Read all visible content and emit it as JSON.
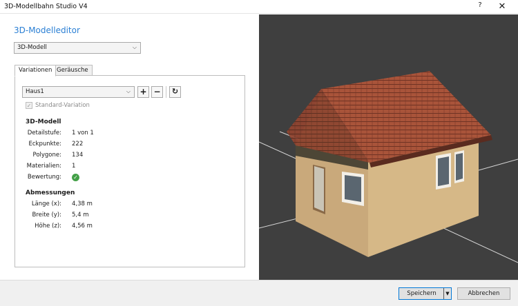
{
  "window": {
    "title": "3D-Modellbahn Studio V4",
    "help_label": "?",
    "close_label": "✕"
  },
  "editor": {
    "heading": "3D-Modelleditor",
    "model_select_value": "3D-Modell",
    "tabs": [
      "Variationen",
      "Geräusche"
    ],
    "variation_select_value": "Haus1",
    "add_label": "+",
    "remove_label": "−",
    "refresh_icon": "↻",
    "standard_variation_label": "Standard-Variation",
    "model_section": {
      "title": "3D-Modell",
      "rows": [
        {
          "label": "Detailstufe:",
          "value": "1 von 1"
        },
        {
          "label": "Eckpunkte:",
          "value": "222"
        },
        {
          "label": "Polygone:",
          "value": "134"
        },
        {
          "label": "Materialien:",
          "value": "1"
        },
        {
          "label": "Bewertung:",
          "value": ""
        }
      ]
    },
    "dimensions_section": {
      "title": "Abmessungen",
      "rows": [
        {
          "label": "Länge (x):",
          "value": "4,38 m"
        },
        {
          "label": "Breite (y):",
          "value": "5,4 m"
        },
        {
          "label": "Höhe (z):",
          "value": "4,56 m"
        }
      ]
    }
  },
  "footer": {
    "save_label": "Speichern",
    "cancel_label": "Abbrechen"
  },
  "colors": {
    "accent": "#2a7fd4",
    "viewport_bg": "#3f3f3f",
    "ok_green": "#43a047"
  }
}
